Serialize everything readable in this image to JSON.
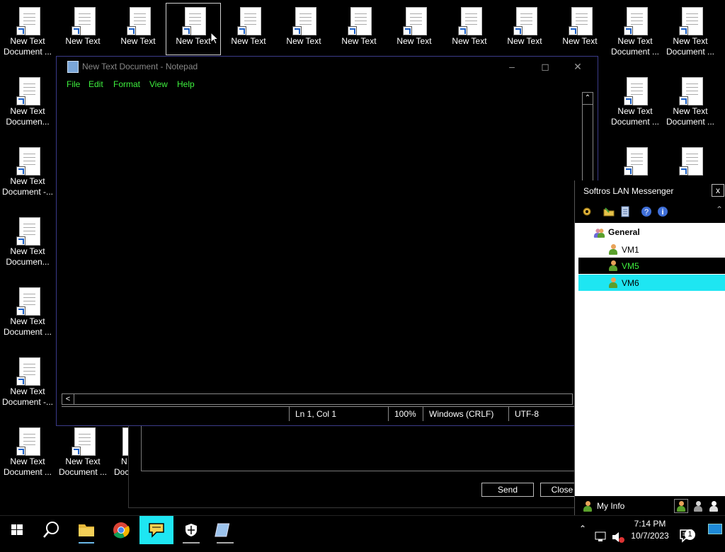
{
  "desktop": {
    "row1": [
      {
        "line1": "New Text",
        "line2": "Document ..."
      },
      {
        "line1": "New Text",
        "line2": ""
      },
      {
        "line1": "New Text",
        "line2": ""
      },
      {
        "line1": "New Text",
        "line2": ""
      },
      {
        "line1": "New Text",
        "line2": ""
      },
      {
        "line1": "New Text",
        "line2": ""
      },
      {
        "line1": "New Text",
        "line2": ""
      },
      {
        "line1": "New Text",
        "line2": ""
      },
      {
        "line1": "New Text",
        "line2": ""
      },
      {
        "line1": "New Text",
        "line2": ""
      },
      {
        "line1": "New Text",
        "line2": ""
      },
      {
        "line1": "New Text",
        "line2": "Document ..."
      },
      {
        "line1": "New Text",
        "line2": "Document ..."
      }
    ],
    "col1": [
      {
        "line1": "New Text",
        "line2": "Documen..."
      },
      {
        "line1": "New Text",
        "line2": "Document -..."
      },
      {
        "line1": "New Text",
        "line2": "Documen..."
      },
      {
        "line1": "New Text",
        "line2": "Document ..."
      },
      {
        "line1": "New Text",
        "line2": "Document -..."
      },
      {
        "line1": "New Text",
        "line2": "Document ..."
      }
    ],
    "right_col": [
      {
        "line1": "New Text",
        "line2": "Document ..."
      },
      {
        "line1": "New Text",
        "line2": "Document ..."
      }
    ],
    "bottom_extra": [
      {
        "line1": "New Text",
        "line2": "Document ..."
      },
      {
        "line1": "N",
        "line2": "Doc"
      }
    ]
  },
  "notepad": {
    "title": "New Text Document - Notepad",
    "menu": [
      "File",
      "Edit",
      "Format",
      "View",
      "Help"
    ],
    "content": "",
    "status": {
      "position": "Ln 1, Col 1",
      "zoom": "100%",
      "line_endings": "Windows (CRLF)",
      "encoding": "UTF-8"
    }
  },
  "chat_window": {
    "send_label": "Send",
    "close_label": "Close"
  },
  "messenger": {
    "title": "Softros LAN Messenger",
    "group": "General",
    "users": [
      "VM1",
      "VM5",
      "VM6"
    ],
    "my_info": "My Info"
  },
  "taskbar": {
    "time": "7:14 PM",
    "date": "10/7/2023",
    "notification_count": "1"
  },
  "colors": {
    "menu_text": "#3ef03e",
    "selection_cyan": "#1ee6f2"
  }
}
